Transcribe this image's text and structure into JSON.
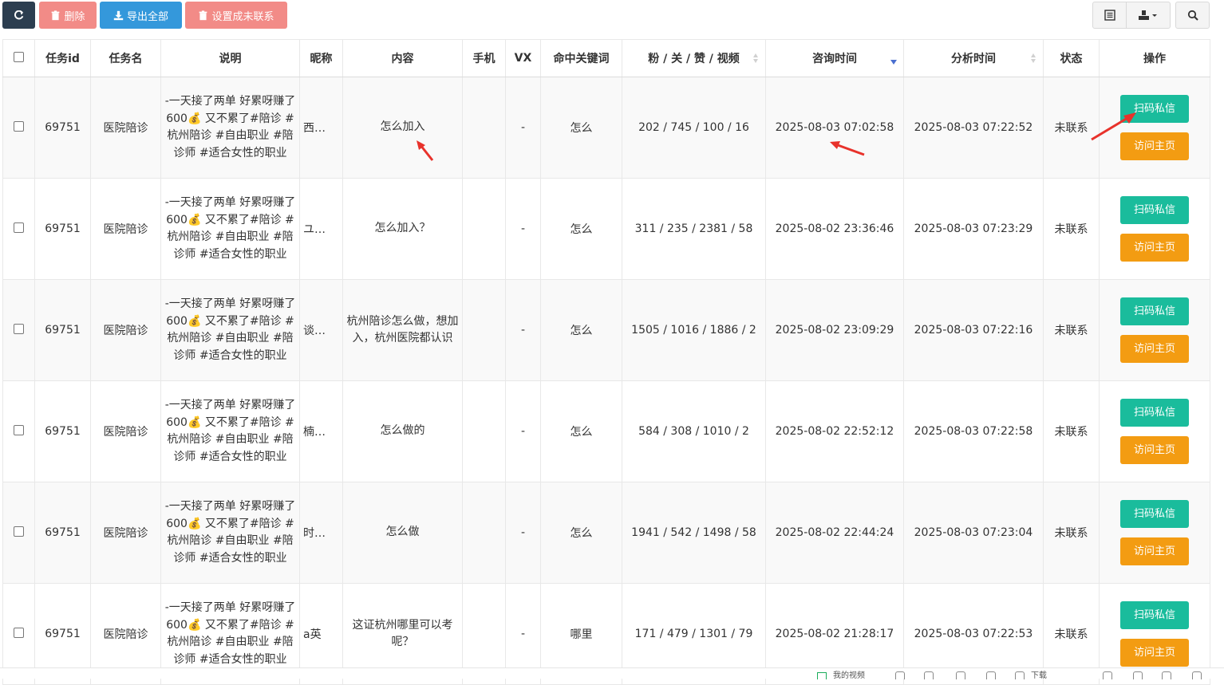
{
  "toolbar": {
    "delete_label": "删除",
    "export_label": "导出全部",
    "set_uncontacted_label": "设置成未联系"
  },
  "table": {
    "headers": [
      "任务id",
      "任务名",
      "说明",
      "昵称",
      "内容",
      "手机",
      "VX",
      "命中关键词",
      "粉 / 关 / 赞 / 视频",
      "咨询时间",
      "分析时间",
      "状态",
      "操作"
    ],
    "rows": [
      {
        "id": "69751",
        "task": "医院陪诊",
        "desc": "-一天接了两单 好累呀赚了600💰 又不累了#陪诊 #杭州陪诊 #自由职业 #陪诊师 #适合女性的职业",
        "nick": "西…",
        "content": "怎么加入",
        "phone": "",
        "vx": "-",
        "keyword": "怎么",
        "stats": "202 / 745 / 100 / 16",
        "consult_time": "2025-08-03 07:02:58",
        "analyze_time": "2025-08-03 07:22:52",
        "status": "未联系",
        "scan_label": "扫码私信",
        "visit_label": "访问主页"
      },
      {
        "id": "69751",
        "task": "医院陪诊",
        "desc": "-一天接了两单 好累呀赚了600💰 又不累了#陪诊 #杭州陪诊 #自由职业 #陪诊师 #适合女性的职业",
        "nick": "ユ…",
        "content": "怎么加入？",
        "phone": "",
        "vx": "-",
        "keyword": "怎么",
        "stats": "311 / 235 / 2381 / 58",
        "consult_time": "2025-08-02 23:36:46",
        "analyze_time": "2025-08-03 07:23:29",
        "status": "未联系",
        "scan_label": "扫码私信",
        "visit_label": "访问主页"
      },
      {
        "id": "69751",
        "task": "医院陪诊",
        "desc": "-一天接了两单 好累呀赚了600💰 又不累了#陪诊 #杭州陪诊 #自由职业 #陪诊师 #适合女性的职业",
        "nick": "谈…",
        "content": "杭州陪诊怎么做，想加入，杭州医院都认识",
        "phone": "",
        "vx": "-",
        "keyword": "怎么",
        "stats": "1505 / 1016 / 1886 / 2",
        "consult_time": "2025-08-02 23:09:29",
        "analyze_time": "2025-08-03 07:22:16",
        "status": "未联系",
        "scan_label": "扫码私信",
        "visit_label": "访问主页"
      },
      {
        "id": "69751",
        "task": "医院陪诊",
        "desc": "-一天接了两单 好累呀赚了600💰 又不累了#陪诊 #杭州陪诊 #自由职业 #陪诊师 #适合女性的职业",
        "nick": "楠…",
        "content": "怎么做的",
        "phone": "",
        "vx": "-",
        "keyword": "怎么",
        "stats": "584 / 308 / 1010 / 2",
        "consult_time": "2025-08-02 22:52:12",
        "analyze_time": "2025-08-03 07:22:58",
        "status": "未联系",
        "scan_label": "扫码私信",
        "visit_label": "访问主页"
      },
      {
        "id": "69751",
        "task": "医院陪诊",
        "desc": "-一天接了两单 好累呀赚了600💰 又不累了#陪诊 #杭州陪诊 #自由职业 #陪诊师 #适合女性的职业",
        "nick": "时…",
        "content": "怎么做",
        "phone": "",
        "vx": "-",
        "keyword": "怎么",
        "stats": "1941 / 542 / 1498 / 58",
        "consult_time": "2025-08-02 22:44:24",
        "analyze_time": "2025-08-03 07:23:04",
        "status": "未联系",
        "scan_label": "扫码私信",
        "visit_label": "访问主页"
      },
      {
        "id": "69751",
        "task": "医院陪诊",
        "desc": "-一天接了两单 好累呀赚了600💰 又不累了#陪诊 #杭州陪诊 #自由职业 #陪诊师 #适合女性的职业",
        "nick": "a英",
        "content": "这证杭州哪里可以考呢？",
        "phone": "",
        "vx": "-",
        "keyword": "哪里",
        "stats": "171 / 479 / 1301 / 79",
        "consult_time": "2025-08-02 21:28:17",
        "analyze_time": "2025-08-03 07:22:53",
        "status": "未联系",
        "scan_label": "扫码私信",
        "visit_label": "访问主页"
      }
    ]
  },
  "statusbar": {
    "my_video_label": "我的视频",
    "download_label": "下载"
  },
  "colors": {
    "refresh": "#2c3e50",
    "danger": "#f28b87",
    "primary": "#3498db",
    "success": "#1abc9c",
    "warning": "#f39c12",
    "annotation_arrow": "#e8322b"
  }
}
